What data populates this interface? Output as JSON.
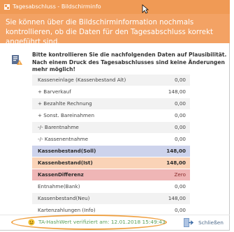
{
  "window": {
    "title": "Tagesabschluss - Bildschirminfo"
  },
  "header": {
    "message": "Sie können über die Bildschirminformation nochmals kontrollieren, ob die Daten für den Tagesabschluss korrekt angeführt sind."
  },
  "notice": {
    "text": "Bitte kontrollieren Sie die nachfolgenden Daten auf Plausibilität. Nach einem Druck des Tagesabschlusses sind keine Änderungen mehr möglich!",
    "icon": "document-warning-icon"
  },
  "table": {
    "rows": [
      {
        "label": "Kasseneinlage (Kassenbestand Alt)",
        "value": "0,00",
        "style": "alt"
      },
      {
        "label": "+ Barverkauf",
        "value": "148,00",
        "style": "white"
      },
      {
        "label": "+ Bezahlte Rechnung",
        "value": "0,00",
        "style": "alt"
      },
      {
        "label": "+ Sonst. Bareinahmen",
        "value": "0,00",
        "style": "white"
      },
      {
        "label": "-/- Barentnahme",
        "value": "0,00",
        "style": "alt"
      },
      {
        "label": "-/- Kassenentnahme",
        "value": "0,00",
        "style": "white"
      },
      {
        "label": "Kassenbestand(Soll)",
        "value": "148,00",
        "style": "soll"
      },
      {
        "label": "Kassenbestand(Ist)",
        "value": "148,00",
        "style": "ist"
      },
      {
        "label": "KassenDifferenz",
        "value": "Zero",
        "style": "diff"
      },
      {
        "label": "Entnahme(Bank)",
        "value": "0,00",
        "style": "white"
      },
      {
        "label": "Kassenbestand(Neu)",
        "value": "148,00",
        "style": "alt"
      },
      {
        "label": "Kartenzahlungen (Info)",
        "value": "0,00",
        "style": "white"
      }
    ]
  },
  "footer": {
    "hash_text": "TA-HashWert verifiziert am: 12.01.2018 15:49:43",
    "close_label": "Schließen"
  },
  "colors": {
    "titlebar": "#f09a55",
    "header": "#f3a264",
    "soll_row": "#cdd3ec",
    "ist_row": "#fad3b7",
    "diff_row": "#efb6b6",
    "highlight_ellipse": "#f0a040"
  }
}
